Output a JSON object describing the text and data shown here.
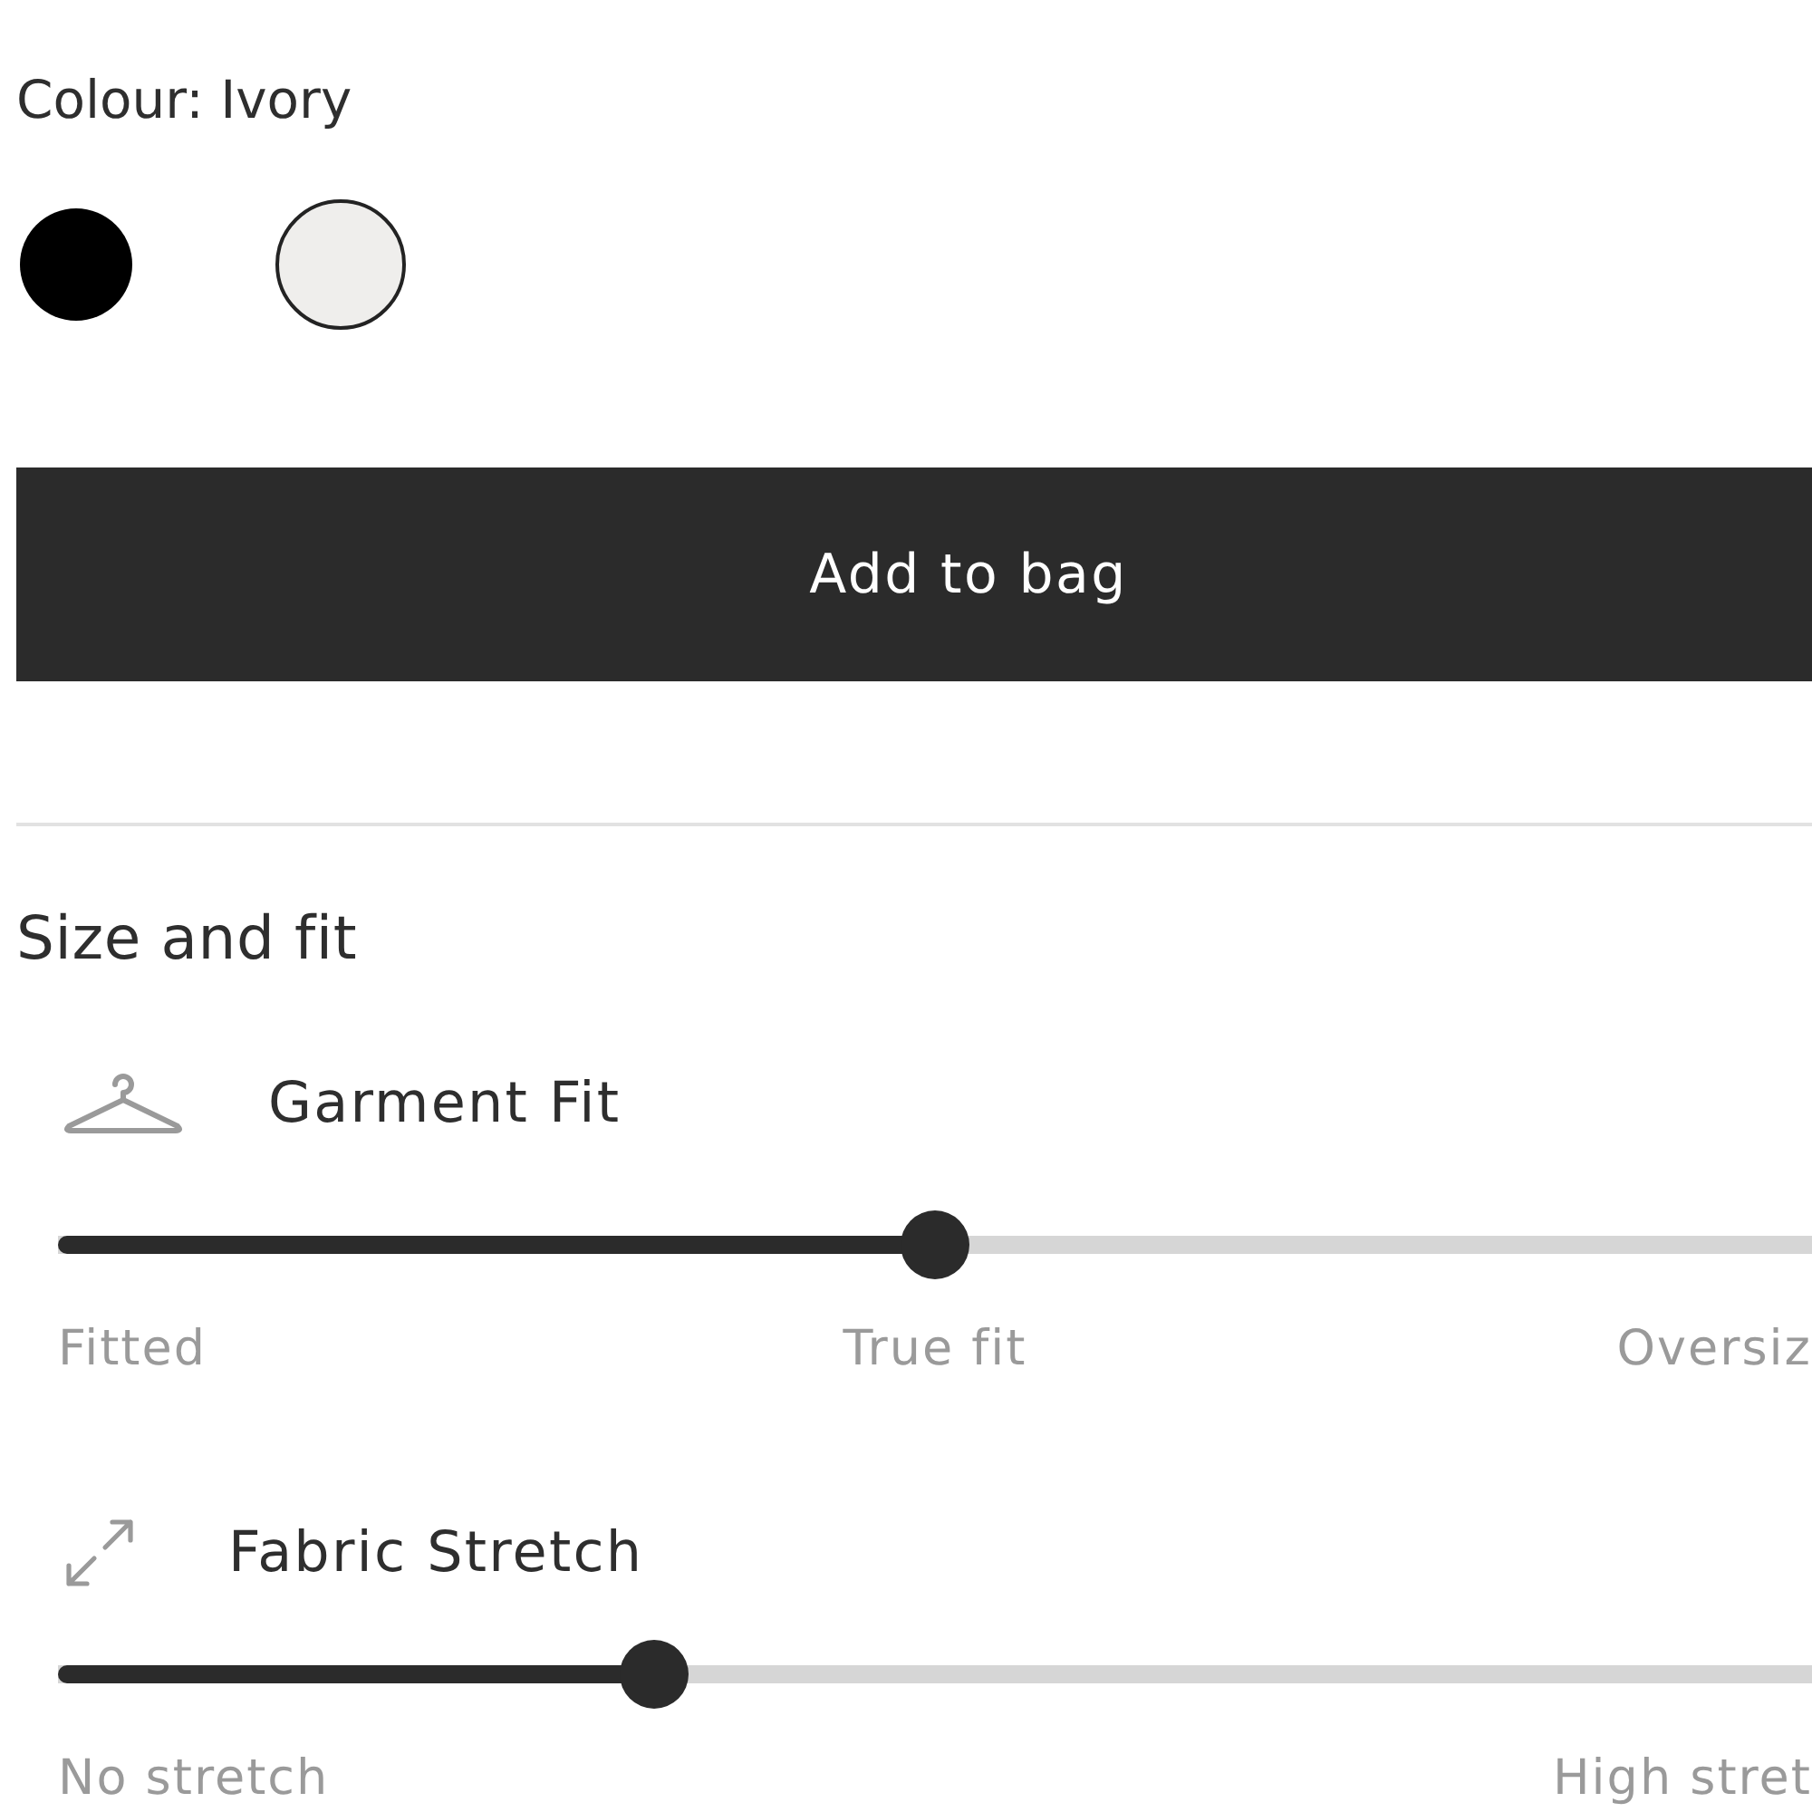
{
  "colour": {
    "label": "Colour: Ivory",
    "swatches": [
      {
        "color": "#000000",
        "selected": false
      },
      {
        "color": "#efeeec",
        "selected": true
      }
    ]
  },
  "add_to_bag_button": {
    "label": "Add to bag"
  },
  "size_and_fit": {
    "title": "Size and fit",
    "sliders": [
      {
        "kind": "hanger",
        "label": "Garment Fit",
        "level": 0.5,
        "scale": [
          "Fitted",
          "True fit",
          "Oversiz"
        ]
      },
      {
        "kind": "stretch",
        "label": "Fabric Stretch",
        "level": 0.34,
        "scale": [
          "No stretch",
          "High stret"
        ]
      }
    ]
  }
}
